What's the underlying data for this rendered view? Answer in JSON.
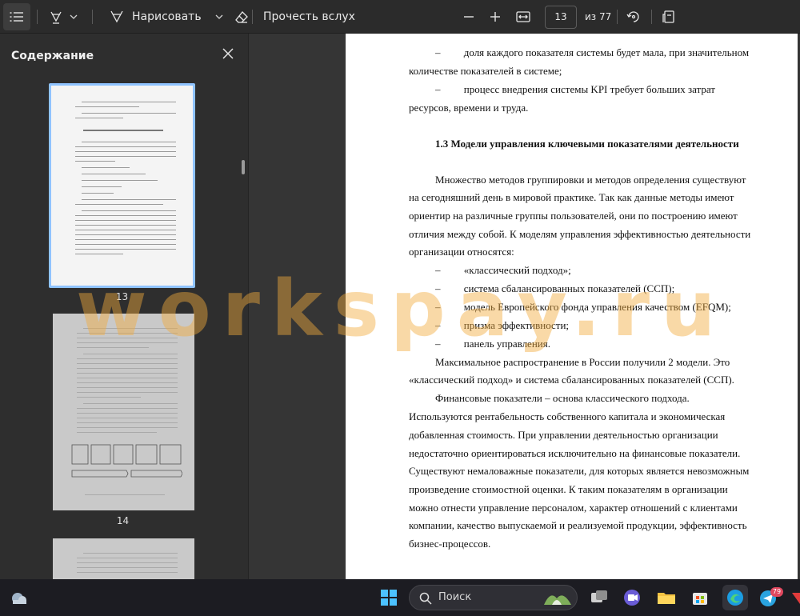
{
  "toolbar": {
    "draw_label": "Нарисовать",
    "read_aloud_label": "Прочесть вслух",
    "page_current": "13",
    "page_total_label": "из 77"
  },
  "sidebar": {
    "title": "Содержание",
    "thumbnails": [
      {
        "number": "13"
      },
      {
        "number": "14"
      }
    ]
  },
  "document": {
    "lines": [
      {
        "text": "–         доля каждого показателя системы будет мала, при значительном"
      },
      {
        "text": "количестве показателей в системе;"
      },
      {
        "text": "–         процесс внедрения системы KPI требует больших затрат"
      },
      {
        "text": "ресурсов, времени и труда."
      },
      {
        "text": "1.3 Модели управления ключевыми показателями деятельности"
      },
      {
        "text": "Множество методов группировки и методов определения существуют"
      },
      {
        "text": "на сегодняшний день в мировой практике. Так как данные методы имеют"
      },
      {
        "text": "ориентир на различные группы пользователей, они по построению имеют"
      },
      {
        "text": "отличия между собой. К моделям управления эффективностью деятельности"
      },
      {
        "text": "организации относятся:"
      },
      {
        "text": "–         «классический подход»;"
      },
      {
        "text": "–         система сбалансированных показателей (ССП);"
      },
      {
        "text": "–         модель Европейского фонда управления качеством (EFQM);"
      },
      {
        "text": "–         призма эффективности;"
      },
      {
        "text": "–         панель управления."
      },
      {
        "text": "Максимальное распространение в России получили 2 модели. Это"
      },
      {
        "text": "«классический подход» и система сбалансированных показателей (ССП)."
      },
      {
        "text": "Финансовые показатели – основа классического подхода."
      },
      {
        "text": "Используются рентабельность собственного капитала и экономическая"
      },
      {
        "text": "добавленная стоимость. При управлении деятельностью организации"
      },
      {
        "text": "недостаточно ориентироваться исключительно на финансовые показатели."
      },
      {
        "text": "Существуют немаловажные показатели, для которых является невозможным"
      },
      {
        "text": "произведение стоимостной оценки. К таким показателям в организации"
      },
      {
        "text": "можно отнести управление персоналом, характер отношений с клиентами"
      },
      {
        "text": "компании, качество выпускаемой и реализуемой продукции, эффективность"
      },
      {
        "text": "бизнес-процессов."
      }
    ]
  },
  "watermark": {
    "text": "workspay.ru"
  },
  "taskbar": {
    "search_label": "Поиск",
    "telegram_badge": "79"
  },
  "colors": {
    "toolbar_bg": "#2b2b2b",
    "sidebar_bg": "#2e2e2e",
    "selection": "#8fc3ff",
    "watermark": "#f2aa3c",
    "taskbar_bg": "#1c1c22"
  }
}
